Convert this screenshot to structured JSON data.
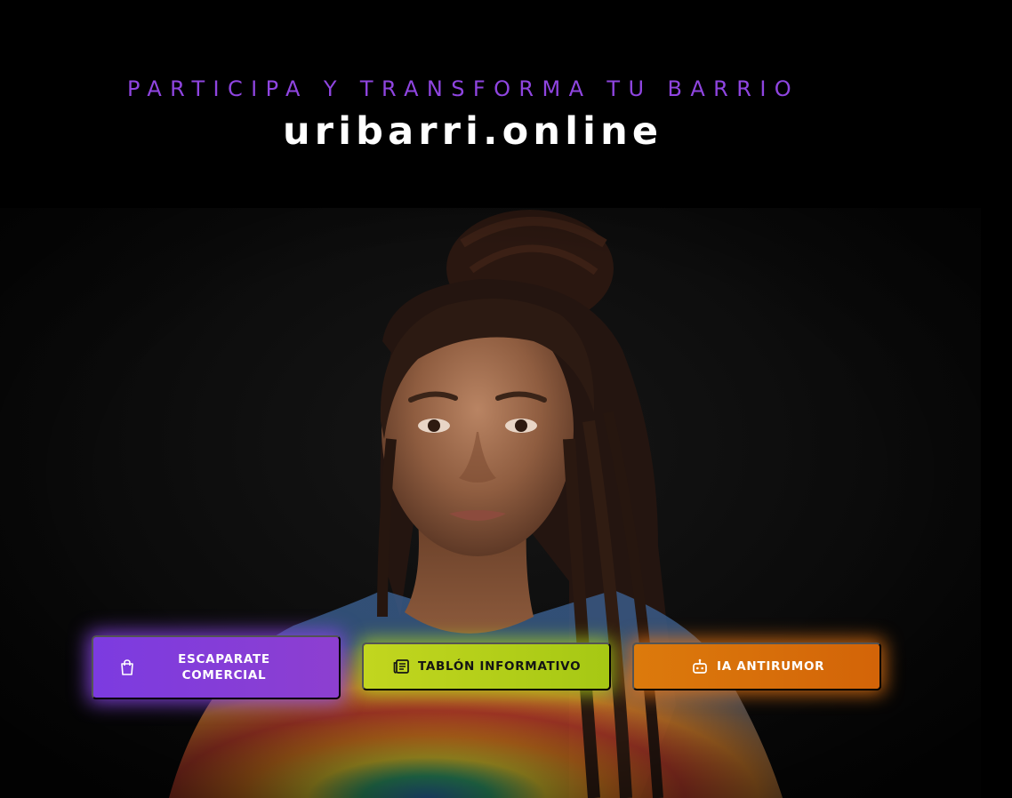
{
  "header": {
    "tagline": "PARTICIPA Y TRANSFORMA TU BARRIO",
    "site_title": "uribarri.online"
  },
  "colors": {
    "tagline": "#8f45e0",
    "background": "#000000",
    "escaparate_button": "#7c3be0",
    "tablon_button": "#b6cf1b",
    "antirumor_button": "#d86d0a"
  },
  "buttons": {
    "escaparate": {
      "label_line1": "ESCAPARATE",
      "label_line2": "COMERCIAL",
      "icon": "shopping-bag-icon"
    },
    "tablon": {
      "label": "TABLÓN INFORMATIVO",
      "icon": "newspaper-icon"
    },
    "antirumor": {
      "label": "IA ANTIRUMOR",
      "icon": "robot-icon"
    }
  }
}
